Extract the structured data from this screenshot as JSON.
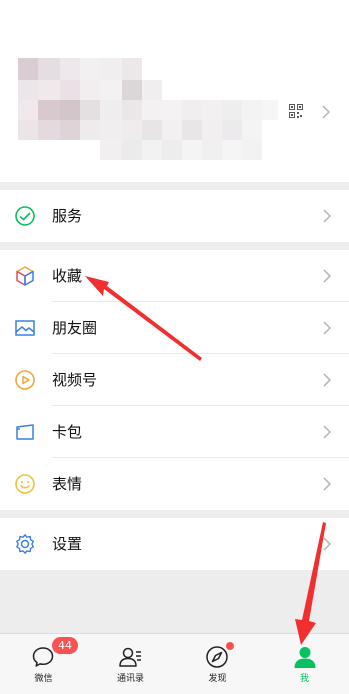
{
  "menu": {
    "services": "服务",
    "favorites": "收藏",
    "moments": "朋友圈",
    "channels": "视频号",
    "cards": "卡包",
    "stickers": "表情",
    "settings": "设置"
  },
  "tabbar": {
    "chats": "微信",
    "chats_badge": "44",
    "contacts": "通讯录",
    "discover": "发现",
    "me": "我"
  },
  "colors": {
    "accent_green": "#07c160",
    "badge_red": "#fa5151",
    "annotation_red": "#f22f2f"
  }
}
